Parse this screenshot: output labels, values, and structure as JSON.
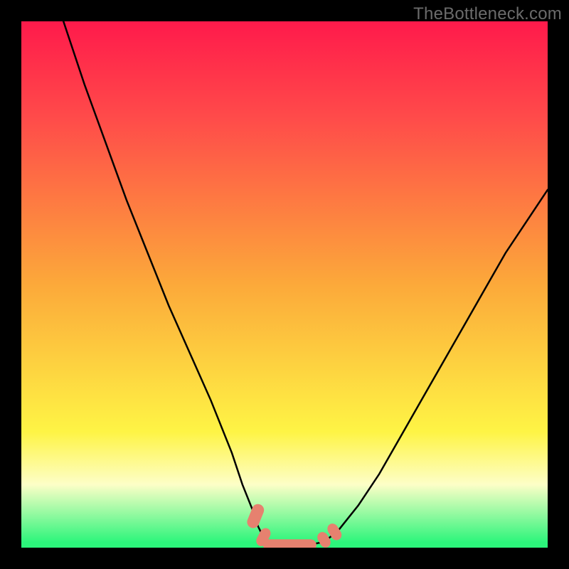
{
  "watermark": "TheBottleneck.com",
  "colors": {
    "top": "#ff1a4b",
    "upper": "#ff4a4a",
    "mid": "#fca93a",
    "lower": "#fef445",
    "cream": "#fdfec7",
    "green": "#2cf57b",
    "salmon": "#e6816f",
    "curve": "#000000"
  },
  "chart_data": {
    "type": "line",
    "title": "",
    "xlabel": "",
    "ylabel": "",
    "xlim": [
      0,
      100
    ],
    "ylim": [
      0,
      100
    ],
    "series": [
      {
        "name": "left-branch",
        "x": [
          8,
          12,
          16,
          20,
          24,
          28,
          32,
          36,
          40,
          42,
          44,
          45,
          46,
          46.5
        ],
        "values": [
          100,
          88,
          77,
          66,
          56,
          46,
          37,
          28,
          18,
          12,
          7,
          4,
          2,
          1
        ]
      },
      {
        "name": "optimal-zone",
        "x": [
          46.5,
          48,
          50,
          52,
          54,
          56,
          57,
          58
        ],
        "values": [
          1,
          0.5,
          0.4,
          0.4,
          0.5,
          0.8,
          1,
          1.5
        ]
      },
      {
        "name": "right-branch",
        "x": [
          58,
          60,
          64,
          68,
          72,
          76,
          80,
          84,
          88,
          92,
          96,
          100
        ],
        "values": [
          1.5,
          3,
          8,
          14,
          21,
          28,
          35,
          42,
          49,
          56,
          62,
          68
        ]
      }
    ],
    "annotations": [
      {
        "name": "salmon-marker-left-upper",
        "x": 44.5,
        "y": 6
      },
      {
        "name": "salmon-marker-left-lower",
        "x": 46,
        "y": 2
      },
      {
        "name": "salmon-marker-bottom-bar",
        "x": 51,
        "y": 0.5
      },
      {
        "name": "salmon-marker-right-lower",
        "x": 57.5,
        "y": 1.5
      },
      {
        "name": "salmon-marker-right-upper",
        "x": 59.5,
        "y": 3
      }
    ]
  }
}
